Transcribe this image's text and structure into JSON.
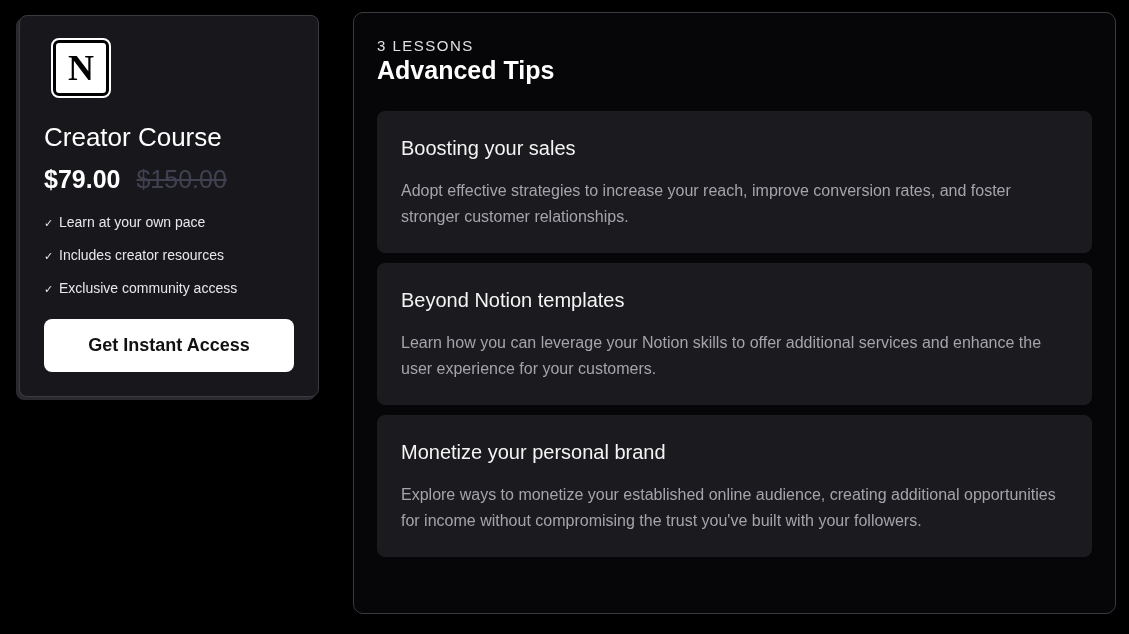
{
  "course_card": {
    "logo_letter": "N",
    "title": "Creator Course",
    "price": "$79.00",
    "original_price": "$150.00",
    "features": [
      {
        "check": "✓",
        "text": "Learn at your own pace"
      },
      {
        "check": "✓",
        "text": "Includes creator resources"
      },
      {
        "check": "✓",
        "text": "Exclusive community access"
      }
    ],
    "button": "Get Instant Access"
  },
  "lessons_panel": {
    "count_label": "3 LESSONS",
    "title": "Advanced Tips",
    "lessons": [
      {
        "title": "Boosting your sales",
        "description": "Adopt effective strategies to increase your reach, improve conversion rates, and foster stronger customer relationships."
      },
      {
        "title": "Beyond Notion templates",
        "description": "Learn how you can leverage your Notion skills to offer additional services and enhance the user experience for your customers."
      },
      {
        "title": "Monetize your personal brand",
        "description": "Explore ways to monetize your established online audience, creating additional opportunities for income without compromising the trust you've built with your followers."
      }
    ]
  }
}
